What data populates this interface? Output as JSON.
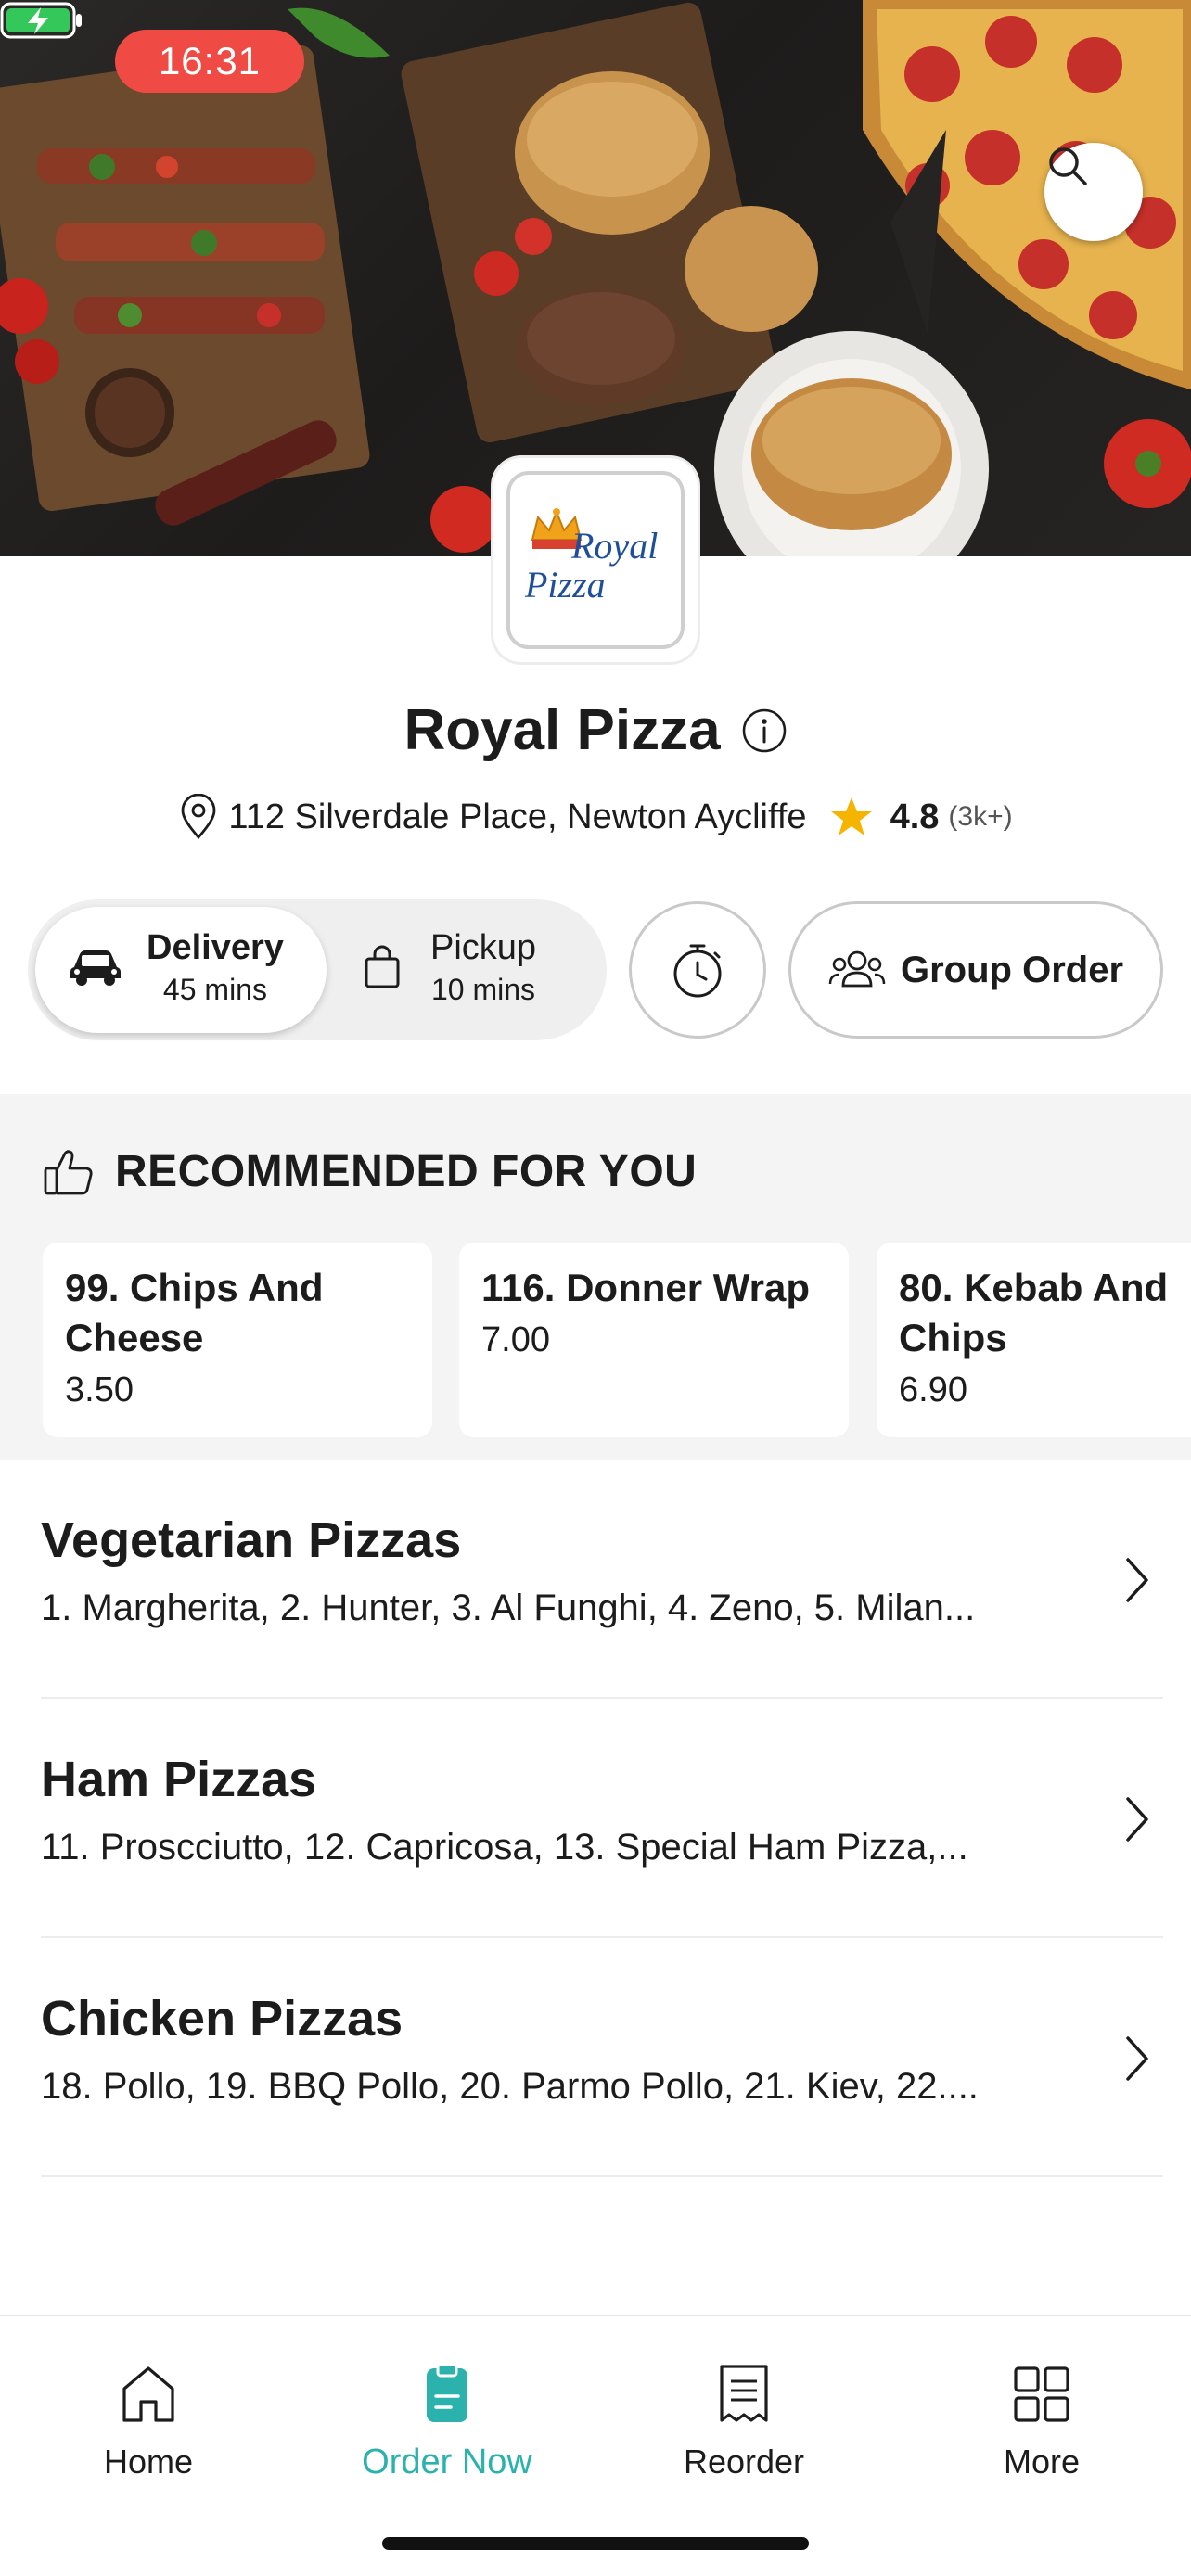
{
  "status_bar": {
    "time": "16:31"
  },
  "store": {
    "name": "Royal Pizza",
    "logo_text": "Royal Pizza",
    "address": "112 Silverdale Place, Newton Aycliffe",
    "rating": "4.8",
    "rating_count": "(3k+)"
  },
  "order_modes": {
    "delivery": {
      "label": "Delivery",
      "time": "45 mins",
      "selected": true
    },
    "pickup": {
      "label": "Pickup",
      "time": "10 mins",
      "selected": false
    }
  },
  "group_order_label": "Group Order",
  "recommended": {
    "title": "RECOMMENDED FOR YOU",
    "items": [
      {
        "name": "99. Chips And Cheese",
        "price": "3.50"
      },
      {
        "name": "116. Donner Wrap",
        "price": "7.00"
      },
      {
        "name": "80. Kebab And Chips",
        "price": "6.90"
      }
    ]
  },
  "categories": [
    {
      "name": "Vegetarian Pizzas",
      "items": "1. Margherita, 2. Hunter, 3. Al Funghi, 4. Zeno, 5. Milan..."
    },
    {
      "name": "Ham Pizzas",
      "items": "11. Proscciutto, 12. Capricosa, 13. Special Ham Pizza,..."
    },
    {
      "name": "Chicken Pizzas",
      "items": "18. Pollo, 19. BBQ Pollo, 20. Parmo Pollo, 21. Kiev, 22...."
    }
  ],
  "tabs": [
    {
      "label": "Home",
      "icon": "home-icon"
    },
    {
      "label": "Order Now",
      "icon": "order-icon",
      "active": true
    },
    {
      "label": "Reorder",
      "icon": "receipt-icon"
    },
    {
      "label": "More",
      "icon": "grid-icon"
    }
  ],
  "colors": {
    "accent": "#2bb2ac",
    "time_pill": "#f04a45",
    "star": "#f5b400",
    "battery": "#34c759"
  }
}
